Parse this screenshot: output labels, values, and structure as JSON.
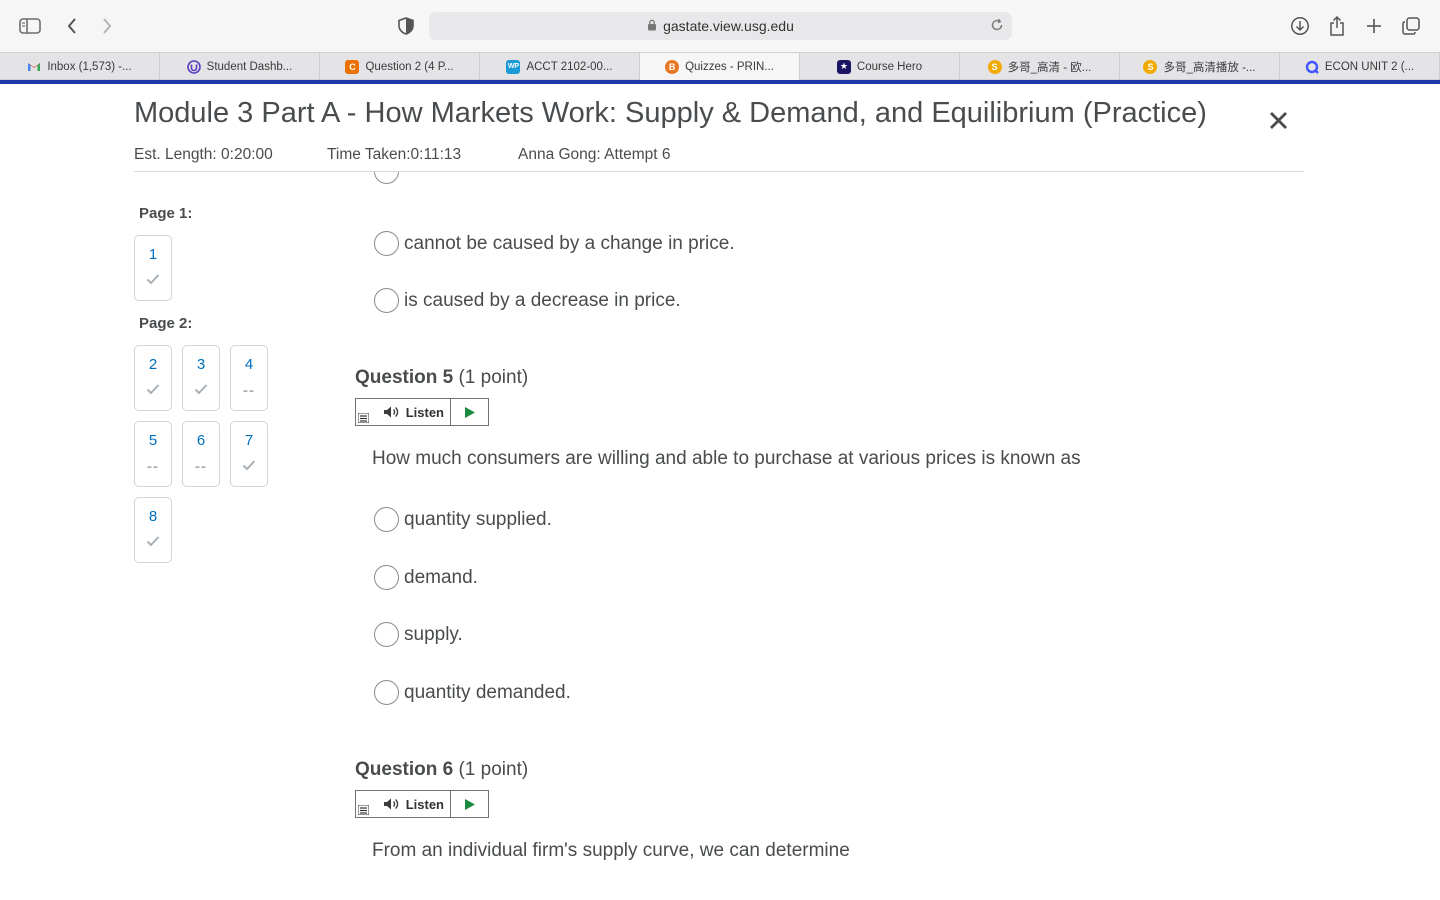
{
  "browser": {
    "url": "gastate.view.usg.edu",
    "tabs": [
      {
        "label": "Inbox (1,573) -...",
        "icon": "gmail-icon",
        "color": "#ea4335"
      },
      {
        "label": "Student Dashb...",
        "icon": "student-dashboard-icon",
        "color": "#5a3fc0"
      },
      {
        "label": "Question 2 (4 P...",
        "icon": "chegg-icon",
        "color": "#eb7100"
      },
      {
        "label": "ACCT 2102-00...",
        "icon": "wp-icon",
        "color": "#1a9ad6"
      },
      {
        "label": "Quizzes - PRIN...",
        "icon": "brightspace-icon",
        "color": "#e87722",
        "active": true
      },
      {
        "label": "Course Hero",
        "icon": "course-hero-icon",
        "color": "#1b1464"
      },
      {
        "label": "多哥_高清 - 欧...",
        "icon": "site-icon",
        "color": "#f2a900"
      },
      {
        "label": "多哥_高清播放 -...",
        "icon": "site-icon",
        "color": "#f2a900"
      },
      {
        "label": "ECON UNIT 2 (...",
        "icon": "quizlet-icon",
        "color": "#4255ff"
      }
    ]
  },
  "quiz": {
    "title": "Module 3 Part A - How Markets Work: Supply & Demand, and Equilibrium (Practice)",
    "est_length": "Est. Length: 0:20:00",
    "time_taken": "Time Taken:0:11:13",
    "attempt": "Anna Gong: Attempt 6"
  },
  "nav": {
    "page1_label": "Page 1:",
    "page2_label": "Page 2:",
    "questions": [
      {
        "num": "1",
        "status": "answered"
      },
      {
        "num": "2",
        "status": "answered"
      },
      {
        "num": "3",
        "status": "answered"
      },
      {
        "num": "4",
        "status": "unanswered"
      },
      {
        "num": "5",
        "status": "unanswered"
      },
      {
        "num": "6",
        "status": "unanswered"
      },
      {
        "num": "7",
        "status": "answered"
      },
      {
        "num": "8",
        "status": "answered"
      }
    ],
    "unanswered_mark": "--"
  },
  "prev_question": {
    "options": [
      "cannot be caused by a change in price.",
      "is caused by a decrease in price."
    ]
  },
  "q5": {
    "label": "Question 5",
    "points": "(1 point)",
    "listen": "Listen",
    "text": "How much consumers are willing and able to purchase at various prices is known as",
    "options": [
      "quantity supplied.",
      "demand.",
      "supply.",
      "quantity demanded."
    ]
  },
  "q6": {
    "label": "Question 6",
    "points": "(1 point)",
    "listen": "Listen",
    "text": "From an individual firm's supply curve, we can determine"
  }
}
